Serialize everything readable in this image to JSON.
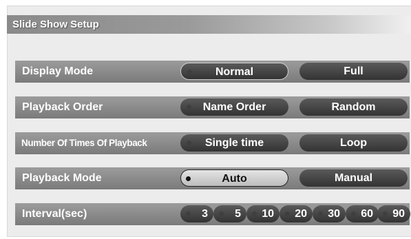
{
  "title": "Slide Show Setup",
  "rows": [
    {
      "label": "Display Mode",
      "options": [
        "Normal",
        "Full"
      ],
      "selected": "Normal"
    },
    {
      "label": "Playback Order",
      "options": [
        "Name Order",
        "Random"
      ],
      "selected": "Name Order"
    },
    {
      "label": "Number Of Times Of Playback",
      "options": [
        "Single time",
        "Loop"
      ],
      "selected": "Single time"
    },
    {
      "label": "Playback Mode",
      "options": [
        "Auto",
        "Manual"
      ],
      "selected": "Auto"
    }
  ],
  "interval": {
    "label": "Interval(sec)",
    "values": [
      "3",
      "5",
      "10",
      "20",
      "30",
      "60",
      "90"
    ],
    "selected": "10"
  }
}
